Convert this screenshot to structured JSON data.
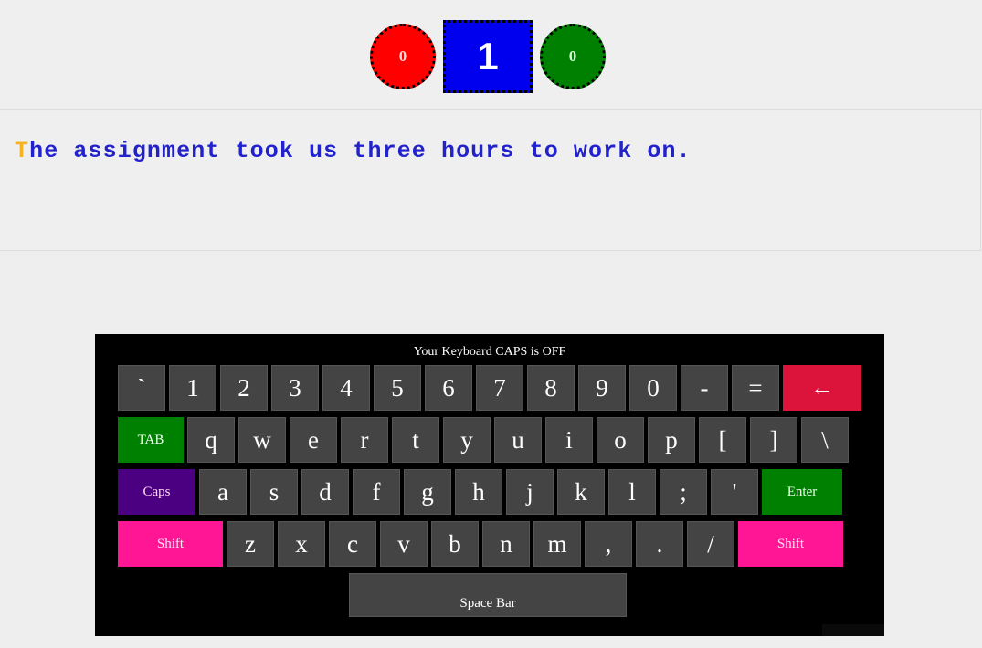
{
  "score": {
    "wrong_label": "0",
    "current_label": "1",
    "right_label": "0",
    "wrong_color": "#ff0000",
    "current_color": "#0000ee",
    "right_color": "#008000"
  },
  "prompt": {
    "typed": "T",
    "pending": "he assignment took us three hours to work on.",
    "full_text": "The assignment took us three hours to work on.",
    "typed_color": "#f5b324",
    "pending_color": "#2222cc"
  },
  "keyboard": {
    "caps_status": "Your Keyboard CAPS is OFF",
    "rows": [
      [
        {
          "label": "`",
          "name": "key-backtick",
          "class": ""
        },
        {
          "label": "1",
          "name": "key-1",
          "class": ""
        },
        {
          "label": "2",
          "name": "key-2",
          "class": ""
        },
        {
          "label": "3",
          "name": "key-3",
          "class": ""
        },
        {
          "label": "4",
          "name": "key-4",
          "class": ""
        },
        {
          "label": "5",
          "name": "key-5",
          "class": ""
        },
        {
          "label": "6",
          "name": "key-6",
          "class": ""
        },
        {
          "label": "7",
          "name": "key-7",
          "class": ""
        },
        {
          "label": "8",
          "name": "key-8",
          "class": ""
        },
        {
          "label": "9",
          "name": "key-9",
          "class": ""
        },
        {
          "label": "0",
          "name": "key-0",
          "class": ""
        },
        {
          "label": "-",
          "name": "key-minus",
          "class": ""
        },
        {
          "label": "=",
          "name": "key-equals",
          "class": ""
        },
        {
          "label": "←",
          "name": "key-backspace",
          "class": "backsp"
        }
      ],
      [
        {
          "label": "TAB",
          "name": "key-tab",
          "class": "tab special"
        },
        {
          "label": "q",
          "name": "key-q",
          "class": ""
        },
        {
          "label": "w",
          "name": "key-w",
          "class": ""
        },
        {
          "label": "e",
          "name": "key-e",
          "class": ""
        },
        {
          "label": "r",
          "name": "key-r",
          "class": ""
        },
        {
          "label": "t",
          "name": "key-t",
          "class": ""
        },
        {
          "label": "y",
          "name": "key-y",
          "class": ""
        },
        {
          "label": "u",
          "name": "key-u",
          "class": ""
        },
        {
          "label": "i",
          "name": "key-i",
          "class": ""
        },
        {
          "label": "o",
          "name": "key-o",
          "class": ""
        },
        {
          "label": "p",
          "name": "key-p",
          "class": ""
        },
        {
          "label": "[",
          "name": "key-bracket-left",
          "class": ""
        },
        {
          "label": "]",
          "name": "key-bracket-right",
          "class": ""
        },
        {
          "label": "\\",
          "name": "key-backslash",
          "class": ""
        }
      ],
      [
        {
          "label": "Caps",
          "name": "key-caps",
          "class": "caps special"
        },
        {
          "label": "a",
          "name": "key-a",
          "class": ""
        },
        {
          "label": "s",
          "name": "key-s",
          "class": ""
        },
        {
          "label": "d",
          "name": "key-d",
          "class": ""
        },
        {
          "label": "f",
          "name": "key-f",
          "class": ""
        },
        {
          "label": "g",
          "name": "key-g",
          "class": ""
        },
        {
          "label": "h",
          "name": "key-h",
          "class": ""
        },
        {
          "label": "j",
          "name": "key-j",
          "class": ""
        },
        {
          "label": "k",
          "name": "key-k",
          "class": ""
        },
        {
          "label": "l",
          "name": "key-l",
          "class": ""
        },
        {
          "label": ";",
          "name": "key-semicolon",
          "class": ""
        },
        {
          "label": "'",
          "name": "key-apostrophe",
          "class": ""
        },
        {
          "label": "Enter",
          "name": "key-enter",
          "class": "enter special"
        }
      ],
      [
        {
          "label": "Shift",
          "name": "key-shift-left",
          "class": "shiftl special"
        },
        {
          "label": "z",
          "name": "key-z",
          "class": ""
        },
        {
          "label": "x",
          "name": "key-x",
          "class": ""
        },
        {
          "label": "c",
          "name": "key-c",
          "class": ""
        },
        {
          "label": "v",
          "name": "key-v",
          "class": ""
        },
        {
          "label": "b",
          "name": "key-b",
          "class": ""
        },
        {
          "label": "n",
          "name": "key-n",
          "class": ""
        },
        {
          "label": "m",
          "name": "key-m",
          "class": ""
        },
        {
          "label": ",",
          "name": "key-comma",
          "class": ""
        },
        {
          "label": ".",
          "name": "key-period",
          "class": ""
        },
        {
          "label": "/",
          "name": "key-slash",
          "class": ""
        },
        {
          "label": "Shift",
          "name": "key-shift-right",
          "class": "shiftr special"
        }
      ]
    ],
    "space_label": "Space Bar",
    "colors": {
      "key_bg": "#444444",
      "tab_bg": "#008000",
      "caps_bg": "#4b0082",
      "enter_bg": "#008000",
      "shift_bg": "#ff1694",
      "backspace_bg": "#dc143c",
      "panel_bg": "#000000"
    }
  }
}
